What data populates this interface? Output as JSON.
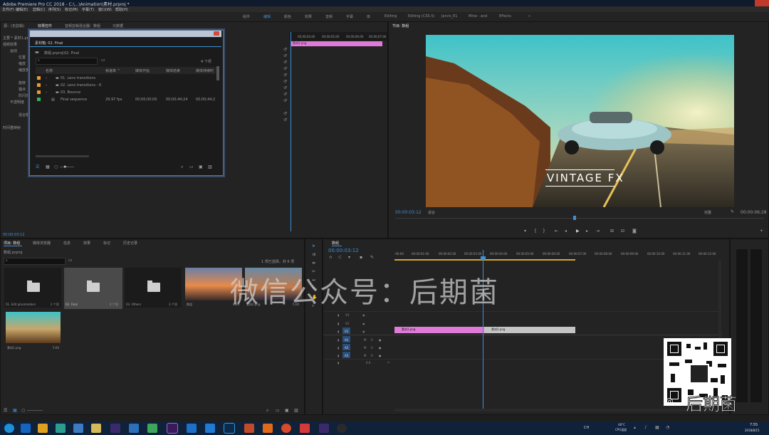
{
  "titlebar": {
    "title": "Adobe Premiere Pro CC 2018 - C:\\...\\Animation\\素材.prproj *"
  },
  "menu": [
    "文件(F)",
    "编辑(E)",
    "剪辑(C)",
    "序列(S)",
    "标记(M)",
    "字幕(T)",
    "窗口(W)",
    "帮助(H)"
  ],
  "workspaces": [
    "组件",
    "编辑",
    "颜色",
    "效果",
    "音频",
    "字幕",
    "库",
    "Editing",
    "Editing (CS5.5)",
    "Jarvis_E1",
    "Mine - and",
    "Effects"
  ],
  "workspace_overflow": "»",
  "effect_controls": {
    "tabs": [
      "源：(无剪辑)",
      "效果控件",
      "音频剪辑混合器：数组",
      "元数据"
    ],
    "rows": [
      "主要 * 素材1.png",
      "视频效果",
      "运动",
      "位置",
      "缩放",
      "缩放宽度",
      "旋转",
      "锚点",
      "防闪烁滤镜",
      "不透明度",
      "混合模式",
      "时间重映射"
    ],
    "time": "00:00:03:12",
    "ruler": [
      "00;00;04;00",
      "00;00;05;00",
      "00;00;06;00",
      "00;00;07;00"
    ],
    "clip_label": "素材2.png"
  },
  "dialog": {
    "title": "素材箱: 02. Final",
    "breadcrumb": "数组.prproj\\02. Final",
    "item_count": "4 个项",
    "columns": [
      "名称",
      "帧速率 ^",
      "媒体开始",
      "媒体结束",
      "媒体持续时"
    ],
    "rows": [
      {
        "name": "01. Lens transitions",
        "color": "#e89a2c",
        "fps": "",
        "start": "",
        "end": "",
        "dur": ""
      },
      {
        "name": "02. Lens transitions - K",
        "color": "#e89a2c",
        "fps": "",
        "start": "",
        "end": "",
        "dur": ""
      },
      {
        "name": "03. Bounce",
        "color": "#e89a2c",
        "fps": "",
        "start": "",
        "end": "",
        "dur": ""
      },
      {
        "name": "Final sequence",
        "color": "#2fb35a",
        "fps": "29.97 fps",
        "start": "00;00;00;00",
        "end": "00;00;44;24",
        "dur": "00;00;44;2"
      }
    ]
  },
  "program": {
    "tab": "节目: 数组",
    "overlay": "VINTAGE FX",
    "timecode": "00:00:03:12",
    "fit": "适合",
    "quality": "完整",
    "duration": "00:00:06:28"
  },
  "project": {
    "tabs": [
      "项目: 数组",
      "媒体浏览器",
      "信息",
      "效果",
      "标记",
      "历史记录"
    ],
    "name": "数组.prproj",
    "selection": "1 项已选择，共 6 项",
    "items": [
      {
        "name": "01. Edit placeholders",
        "meta": "2 个项",
        "type": "folder"
      },
      {
        "name": "02. Final",
        "meta": "4 个项",
        "type": "folder"
      },
      {
        "name": "03. Others",
        "meta": "3 个项",
        "type": "folder"
      },
      {
        "name": "数组",
        "meta": "6:28",
        "type": "seq"
      },
      {
        "name": "素材2.png",
        "meta": "5:00",
        "type": "img"
      },
      {
        "name": "素材1.png",
        "meta": "5:00",
        "type": "img"
      }
    ]
  },
  "timeline": {
    "tab": "数组",
    "timecode": "00:00:03:12",
    "ruler": [
      ":00:00",
      "00:00:01:00",
      "00:00:02:00",
      "00:00:03:00",
      "00:00:04:00",
      "00:00:05:00",
      "00:00:06:00",
      "00:00:07:00",
      "00:00:08:00",
      "00:00:09:00",
      "00:00:10:00",
      "00:00:11:00",
      "00:00:12:00"
    ],
    "tracks": [
      "V3",
      "V2",
      "V1",
      "A1",
      "A2",
      "A3"
    ],
    "track_buttons": [
      "M",
      "S"
    ],
    "master_value": "0.0",
    "clips": [
      {
        "name": "素材1.png",
        "color": "#e07ad8"
      },
      {
        "name": "素材2.png",
        "color": "#c4c4c4"
      }
    ]
  },
  "watermark": "微信公众号：后期菌",
  "brand": "后期菌",
  "taskbar": {
    "apps": [
      "Start",
      "Internet Explorer",
      "Chrome",
      "Explorer",
      "Store",
      "Premiere",
      "After Effects",
      "Photoshop"
    ],
    "tray": [
      "48°C",
      "CPU温度"
    ],
    "time": "7:55",
    "date": "2018/8/15",
    "lang": "CH"
  }
}
